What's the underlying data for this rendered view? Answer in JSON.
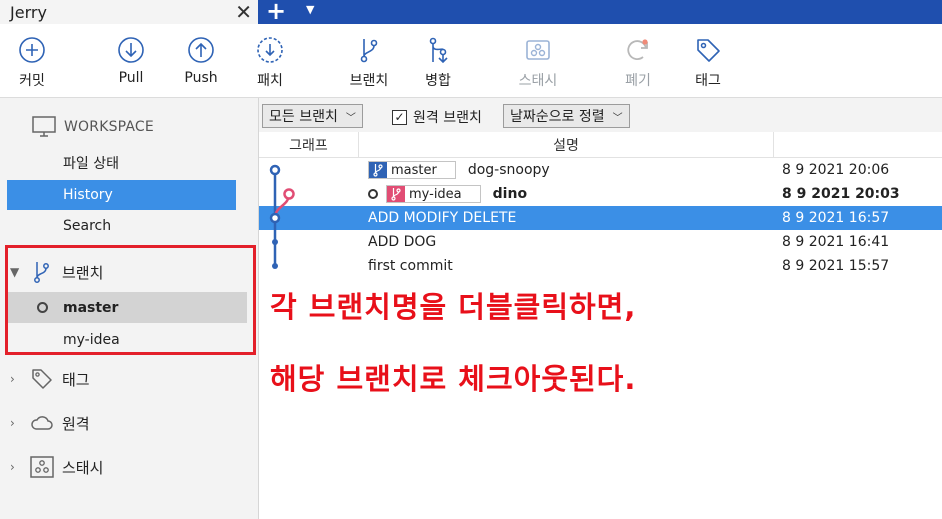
{
  "tab": {
    "title": "Jerry",
    "close": "✕",
    "add": "+",
    "dropdown": "▼"
  },
  "toolbar": {
    "commit": "커밋",
    "pull": "Pull",
    "push": "Push",
    "patch": "패치",
    "branch": "브랜치",
    "merge": "병합",
    "stash": "스태시",
    "discard": "폐기",
    "tag": "태그"
  },
  "sidebar": {
    "workspace": "WORKSPACE",
    "items": [
      {
        "label": "파일 상태"
      },
      {
        "label": "History",
        "selected": true
      },
      {
        "label": "Search"
      }
    ],
    "branches_header": "브랜치",
    "branches": [
      {
        "label": "master",
        "current": true
      },
      {
        "label": "my-idea"
      }
    ],
    "tags_header": "태그",
    "remotes_header": "원격",
    "stash_header": "스태시"
  },
  "filter": {
    "all_branches": "모든 브랜치",
    "remote_branches": "원격 브랜치",
    "remote_checked": true,
    "sort": "날짜순으로 정렬"
  },
  "columns": {
    "graph": "그래프",
    "description": "설명"
  },
  "commits": [
    {
      "branch": "master",
      "message": "dog-snoopy",
      "date": "8 9 2021 20:06"
    },
    {
      "branch": "my-idea",
      "message": "dino",
      "date": "8 9 2021 20:03"
    },
    {
      "message": "ADD MODIFY DELETE",
      "date": "8 9 2021 16:57"
    },
    {
      "message": "ADD DOG",
      "date": "8 9 2021 16:41"
    },
    {
      "message": "first commit",
      "date": "8 9 2021 15:57"
    }
  ],
  "annotation": {
    "line1": "각 브랜치명을 더블클릭하면,",
    "line2": "해당 브랜치로 체크아웃된다."
  },
  "colors": {
    "accent": "#3b8fe6",
    "titlebar": "#1f4fae",
    "annotation": "#e8101a",
    "master_tag": "#2f63b5",
    "idea_tag": "#e14d74"
  }
}
